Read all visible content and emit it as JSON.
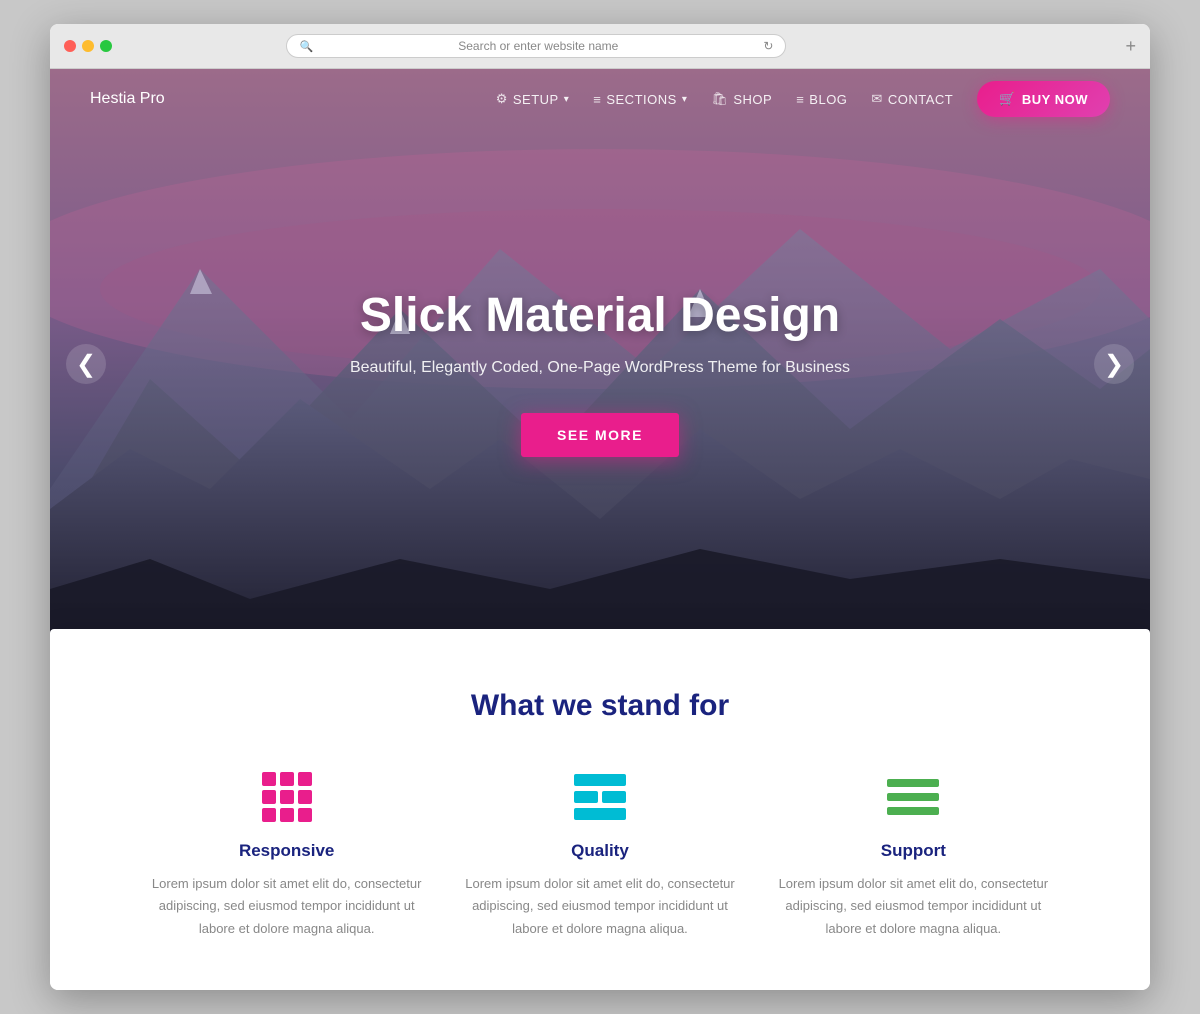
{
  "browser": {
    "address_placeholder": "Search or enter website name"
  },
  "navbar": {
    "brand": "Hestia Pro",
    "links": [
      {
        "id": "setup",
        "label": "SETUP",
        "icon": "⚙",
        "hasDropdown": true
      },
      {
        "id": "sections",
        "label": "SECTIONS",
        "icon": "☰",
        "hasDropdown": true
      },
      {
        "id": "shop",
        "label": "SHOP",
        "icon": "🛍",
        "hasDropdown": false
      },
      {
        "id": "blog",
        "label": "BLOG",
        "icon": "☰",
        "hasDropdown": false
      },
      {
        "id": "contact",
        "label": "CONTACT",
        "icon": "✉",
        "hasDropdown": false
      }
    ],
    "cta_label": "BUY NOW",
    "cta_icon": "🛒"
  },
  "hero": {
    "title": "Slick Material Design",
    "subtitle": "Beautiful, Elegantly Coded, One-Page WordPress Theme for Business",
    "cta_label": "SEE MORE",
    "arrow_left": "❮",
    "arrow_right": "❯"
  },
  "features": {
    "section_title": "What we stand for",
    "items": [
      {
        "id": "responsive",
        "name": "Responsive",
        "description": "Lorem ipsum dolor sit amet elit do, consectetur adipiscing, sed eiusmod tempor incididunt ut labore et dolore magna aliqua."
      },
      {
        "id": "quality",
        "name": "Quality",
        "description": "Lorem ipsum dolor sit amet elit do, consectetur adipiscing, sed eiusmod tempor incididunt ut labore et dolore magna aliqua."
      },
      {
        "id": "support",
        "name": "Support",
        "description": "Lorem ipsum dolor sit amet elit do, consectetur adipiscing, sed eiusmod tempor incididunt ut labore et dolore magna aliqua."
      }
    ]
  }
}
